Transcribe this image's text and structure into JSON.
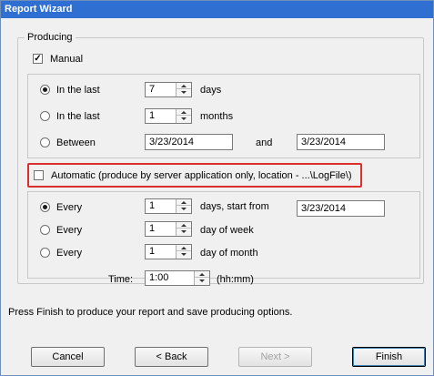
{
  "window": {
    "title": "Report Wizard"
  },
  "producing": {
    "legend": "Producing",
    "manual": {
      "label": "Manual",
      "checked": true,
      "options": [
        {
          "label": "In the last",
          "value": "7",
          "unit": "days",
          "selected": true
        },
        {
          "label": "In the last",
          "value": "1",
          "unit": "months",
          "selected": false
        },
        {
          "label": "Between",
          "from": "3/23/2014",
          "and_label": "and",
          "to": "3/23/2014",
          "selected": false
        }
      ]
    },
    "automatic": {
      "label": "Automatic (produce by server application only, location - ...\\LogFile\\)",
      "checked": false,
      "options": [
        {
          "label": "Every",
          "value": "1",
          "unit": "days, start from",
          "start": "3/23/2014",
          "selected": true
        },
        {
          "label": "Every",
          "value": "1",
          "unit": "day of week",
          "selected": false
        },
        {
          "label": "Every",
          "value": "1",
          "unit": "day of month",
          "selected": false
        }
      ],
      "time": {
        "label": "Time:",
        "value": "1:00",
        "format": "(hh:mm)"
      }
    }
  },
  "hint": "Press Finish to produce your report and save producing options.",
  "buttons": {
    "cancel": "Cancel",
    "back": "< Back",
    "next": "Next >",
    "finish": "Finish"
  },
  "colors": {
    "title_bar": "#2f6fd2",
    "highlight_border": "#d9302e"
  }
}
